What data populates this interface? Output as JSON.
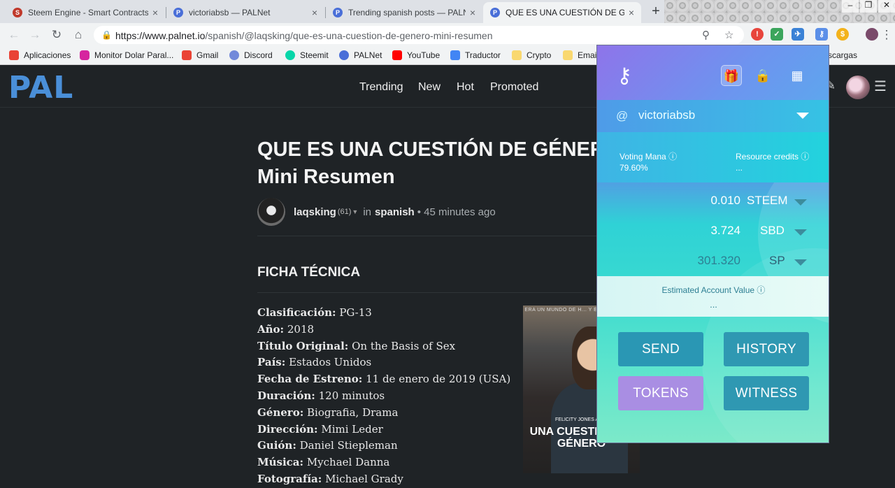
{
  "browser": {
    "tabs": [
      {
        "title": "Steem Engine - Smart Contracts",
        "icon_color": "#c0392b",
        "active": false
      },
      {
        "title": "victoriabsb — PALNet",
        "icon_color": "#4a6fd8",
        "active": false
      },
      {
        "title": "Trending spanish posts — PALNet",
        "icon_color": "#4a6fd8",
        "active": false
      },
      {
        "title": "QUE ES UNA CUESTIÓN DE GÉNERO",
        "icon_color": "#4a6fd8",
        "active": true
      }
    ],
    "new_tab_icon": "plus-icon",
    "url_host": "https://www.palnet.io",
    "url_path": "/spanish/@laqsking/que-es-una-cuestion-de-genero-mini-resumen",
    "bookmarks": [
      {
        "label": "Aplicaciones",
        "color": "#e94235"
      },
      {
        "label": "Monitor Dolar Paral...",
        "color": "#d6249f"
      },
      {
        "label": "Gmail",
        "color": "#ea4335"
      },
      {
        "label": "Discord",
        "color": "#7289da"
      },
      {
        "label": "Steemit",
        "color": "#06d6a9"
      },
      {
        "label": "PALNet",
        "color": "#4a6fd8"
      },
      {
        "label": "YouTube",
        "color": "#ff0000"
      },
      {
        "label": "Traductor",
        "color": "#4285f4"
      },
      {
        "label": "Crypto",
        "color": "#f9d870"
      },
      {
        "label": "Email",
        "color": "#f9d870"
      },
      {
        "label": "scargas",
        "color": "#f9d870"
      }
    ]
  },
  "site": {
    "logo": "PAL",
    "nav": [
      "Trending",
      "New",
      "Hot",
      "Promoted"
    ]
  },
  "article": {
    "title_line1": "QUE ES UNA CUESTIÓN DE GÉNERO",
    "title_line2": "Mini Resumen",
    "author": "laqsking",
    "reputation": "(61)",
    "in_label": "in",
    "community": "spanish",
    "time": "• 45 minutes ago",
    "section": "FICHA TÉCNICA",
    "specs": [
      {
        "k": "Clasificación:",
        "v": "PG-13"
      },
      {
        "k": "Año:",
        "v": "2018"
      },
      {
        "k": "Título Original:",
        "v": "On the Basis of Sex"
      },
      {
        "k": "País:",
        "v": "Estados Unidos"
      },
      {
        "k": "Fecha de Estreno:",
        "v": "11 de enero de 2019 (USA)"
      },
      {
        "k": "Duración:",
        "v": "120 minutos"
      },
      {
        "k": "Género:",
        "v": "Biografia, Drama"
      },
      {
        "k": "Dirección:",
        "v": "Mimi Leder"
      },
      {
        "k": "Guión:",
        "v": "Daniel Stiepleman"
      },
      {
        "k": "Música:",
        "v": "Mychael Danna"
      },
      {
        "k": "Fotografía:",
        "v": "Michael Grady"
      }
    ],
    "poster": {
      "tagline": "ERA UN MUNDO DE H... Y ELLA LO CAMB...",
      "cast": "FELICITY JONES   ARMI",
      "title": "UNA CUESTIÓN DE GÉNERO"
    }
  },
  "wallet": {
    "username": "victoriabsb",
    "at": "@",
    "voting_mana_label": "Voting Mana",
    "voting_mana_value": "79.60%",
    "rc_label": "Resource credits",
    "rc_value": "...",
    "balances": [
      {
        "amount": "0.010",
        "currency": "STEEM"
      },
      {
        "amount": "3.724",
        "currency": "SBD"
      },
      {
        "amount": "301.320",
        "currency": "SP"
      }
    ],
    "estimated_label": "Estimated Account Value",
    "estimated_value": "...",
    "actions": {
      "send": "SEND",
      "history": "HISTORY",
      "tokens": "TOKENS",
      "witness": "WITNESS"
    }
  }
}
